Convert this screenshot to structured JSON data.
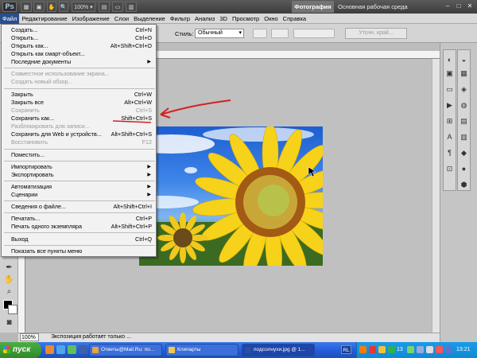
{
  "appbar": {
    "logo": "Ps",
    "zoom": "100%",
    "workspace_active": "Фотография",
    "workspace_name": "Основная рабочая среда",
    "win_controls": [
      "–",
      "□",
      "✕"
    ]
  },
  "menubar": [
    "Файл",
    "Редактирование",
    "Изображение",
    "Слои",
    "Выделение",
    "Фильтр",
    "Анализ",
    "3D",
    "Просмотр",
    "Окно",
    "Справка"
  ],
  "options": {
    "style_label": "Стиль:",
    "style_value": "Обычный",
    "refine_button": "Уточн. край..."
  },
  "file_menu": [
    {
      "label": "Создать...",
      "shortcut": "Ctrl+N"
    },
    {
      "label": "Открыть...",
      "shortcut": "Ctrl+O"
    },
    {
      "label": "Открыть как...",
      "shortcut": "Alt+Shift+Ctrl+O"
    },
    {
      "label": "Открыть как смарт-объект...",
      "shortcut": ""
    },
    {
      "label": "Последние документы",
      "shortcut": "",
      "submenu": true
    },
    {
      "label": "Совместное использование экрана...",
      "shortcut": "",
      "disabled": true
    },
    {
      "label": "Создать новый обзор...",
      "shortcut": "",
      "disabled": true
    },
    {
      "label": "Закрыть",
      "shortcut": "Ctrl+W"
    },
    {
      "label": "Закрыть все",
      "shortcut": "Alt+Ctrl+W"
    },
    {
      "label": "Сохранить",
      "shortcut": "Ctrl+S",
      "disabled": true
    },
    {
      "label": "Сохранить как...",
      "shortcut": "Shift+Ctrl+S"
    },
    {
      "label": "Разблокировать для записи...",
      "shortcut": "",
      "disabled": true
    },
    {
      "label": "Сохранить для Web и устройств...",
      "shortcut": "Alt+Shift+Ctrl+S"
    },
    {
      "label": "Восстановить",
      "shortcut": "F12",
      "disabled": true
    },
    {
      "label": "Поместить...",
      "shortcut": ""
    },
    {
      "label": "Импортировать",
      "shortcut": "",
      "submenu": true
    },
    {
      "label": "Экспортировать",
      "shortcut": "",
      "submenu": true
    },
    {
      "label": "Автоматизация",
      "shortcut": "",
      "submenu": true
    },
    {
      "label": "Сценарии",
      "shortcut": "",
      "submenu": true
    },
    {
      "label": "Сведения о файле...",
      "shortcut": "Alt+Shift+Ctrl+I"
    },
    {
      "label": "Печатать...",
      "shortcut": "Ctrl+P"
    },
    {
      "label": "Печать одного экземпляра",
      "shortcut": "Alt+Shift+Ctrl+P"
    },
    {
      "label": "Выход",
      "shortcut": "Ctrl+Q"
    },
    {
      "label": "Показать все пункты меню",
      "shortcut": ""
    }
  ],
  "status": {
    "zoom": "100%",
    "text": "Экспозиция работает только ..."
  },
  "taskbar": {
    "start": "пуск",
    "tasks": [
      {
        "label": "Ответы@Mail.Ru: по...",
        "color": "#e8a33b"
      },
      {
        "label": "Клипарты",
        "color": "#f1c84a"
      },
      {
        "label": "подсолнухи.jpg @ 1...",
        "color": "#2a4f9f",
        "active": true
      }
    ],
    "lang": "RL",
    "clock": "13:21",
    "tray_badge": "13"
  }
}
